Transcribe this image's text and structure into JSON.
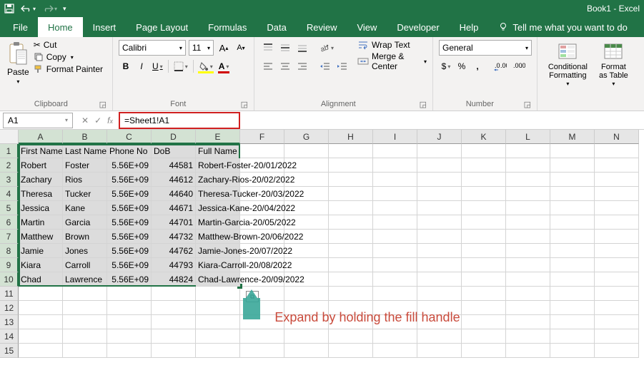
{
  "titlebar": {
    "title": "Book1 - Excel"
  },
  "tabs": [
    "File",
    "Home",
    "Insert",
    "Page Layout",
    "Formulas",
    "Data",
    "Review",
    "View",
    "Developer",
    "Help"
  ],
  "active_tab": "Home",
  "tell_me": "Tell me what you want to do",
  "ribbon": {
    "clipboard": {
      "paste": "Paste",
      "cut": "Cut",
      "copy": "Copy",
      "format_painter": "Format Painter",
      "label": "Clipboard"
    },
    "font": {
      "name": "Calibri",
      "size": "11",
      "label": "Font"
    },
    "alignment": {
      "wrap": "Wrap Text",
      "merge": "Merge & Center",
      "label": "Alignment"
    },
    "number": {
      "format": "General",
      "label": "Number"
    },
    "styles": {
      "cond": "Conditional Formatting",
      "table": "Format as Table"
    }
  },
  "namebox": "A1",
  "formula": "=Sheet1!A1",
  "columns": [
    "A",
    "B",
    "C",
    "D",
    "E",
    "F",
    "G",
    "H",
    "I",
    "J",
    "K",
    "L",
    "M",
    "N"
  ],
  "row_numbers": [
    1,
    2,
    3,
    4,
    5,
    6,
    7,
    8,
    9,
    10,
    11,
    12,
    13,
    14,
    15
  ],
  "headers": [
    "First Name",
    "Last Name",
    "Phone No",
    "DoB",
    "Full Name"
  ],
  "data_rows": [
    {
      "a": "Robert",
      "b": "Foster",
      "c": "5.56E+09",
      "d": "44581",
      "e": "Robert-Foster-20/01/2022"
    },
    {
      "a": "Zachary",
      "b": "Rios",
      "c": "5.56E+09",
      "d": "44612",
      "e": "Zachary-Rios-20/02/2022"
    },
    {
      "a": "Theresa",
      "b": "Tucker",
      "c": "5.56E+09",
      "d": "44640",
      "e": "Theresa-Tucker-20/03/2022"
    },
    {
      "a": "Jessica",
      "b": "Kane",
      "c": "5.56E+09",
      "d": "44671",
      "e": "Jessica-Kane-20/04/2022"
    },
    {
      "a": "Martin",
      "b": "Garcia",
      "c": "5.56E+09",
      "d": "44701",
      "e": "Martin-Garcia-20/05/2022"
    },
    {
      "a": "Matthew",
      "b": "Brown",
      "c": "5.56E+09",
      "d": "44732",
      "e": "Matthew-Brown-20/06/2022"
    },
    {
      "a": "Jamie",
      "b": "Jones",
      "c": "5.56E+09",
      "d": "44762",
      "e": "Jamie-Jones-20/07/2022"
    },
    {
      "a": "Kiara",
      "b": "Carroll",
      "c": "5.56E+09",
      "d": "44793",
      "e": "Kiara-Carroll-20/08/2022"
    },
    {
      "a": "Chad",
      "b": "Lawrence",
      "c": "5.56E+09",
      "d": "44824",
      "e": "Chad-Lawrence-20/09/2022"
    }
  ],
  "annotation": "Expand by holding the fill handle"
}
